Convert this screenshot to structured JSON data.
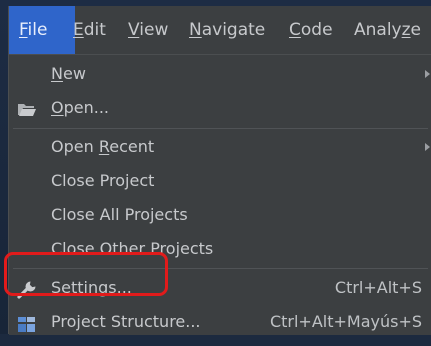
{
  "menubar": {
    "items": [
      {
        "label": "File",
        "mnemonic": "F",
        "rest": "ile",
        "active": true
      },
      {
        "label": "Edit",
        "mnemonic": "E",
        "rest": "dit"
      },
      {
        "label": "View",
        "mnemonic": "V",
        "rest": "iew"
      },
      {
        "label": "Navigate",
        "mnemonic": "N",
        "rest": "avigate"
      },
      {
        "label": "Code",
        "mnemonic": "C",
        "rest": "ode"
      },
      {
        "label": "Analyze",
        "pre": "Analy",
        "mnemonic": "z",
        "rest": "e"
      }
    ]
  },
  "file_menu": {
    "items": [
      {
        "label": "New",
        "mnemonic": "N",
        "rest": "ew",
        "submenu": true
      },
      {
        "label": "Open...",
        "mnemonic": "O",
        "rest": "pen...",
        "icon": "folder-icon"
      },
      {
        "label": "Open Recent",
        "pre": "Open ",
        "mnemonic": "R",
        "rest": "ecent",
        "submenu": true
      },
      {
        "label": "Close Project"
      },
      {
        "label": "Close All Projects"
      },
      {
        "label": "Close Other Projects"
      },
      {
        "label": "Settings...",
        "pre": "Se",
        "mnemonic": "t",
        "rest": "tings...",
        "shortcut": "Ctrl+Alt+S",
        "icon": "wrench-icon",
        "highlighted": true
      },
      {
        "label": "Project Structure...",
        "shortcut": "Ctrl+Alt+Mayús+S",
        "icon": "project-structure-icon"
      }
    ]
  },
  "colors": {
    "menu_background": "#3c3f41",
    "active_menu": "#2f65ca",
    "highlight_ring": "#e11b1b",
    "text": "#c7c9cc",
    "backdrop": "#1c2a3f"
  }
}
